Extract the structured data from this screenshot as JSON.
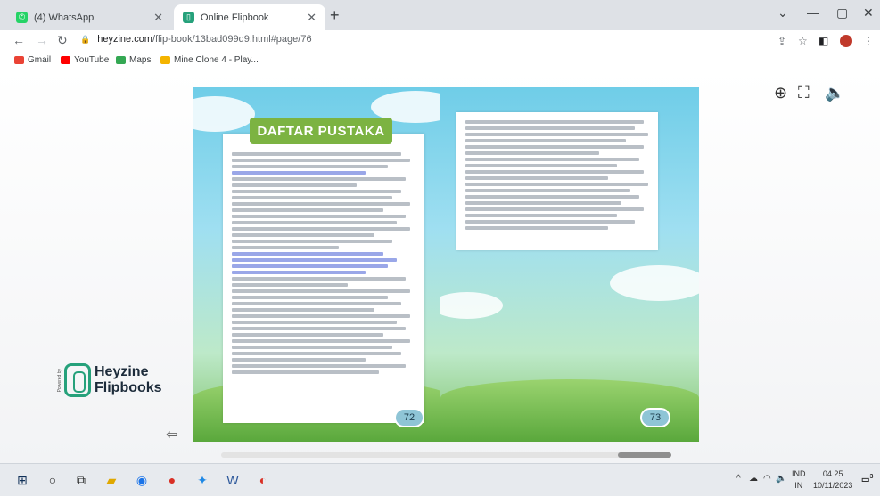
{
  "browser": {
    "tabs": [
      {
        "label": "(4) WhatsApp",
        "active": false,
        "icon": "whatsapp-icon",
        "color": "#25d366"
      },
      {
        "label": "Online Flipbook",
        "active": true,
        "icon": "heyzine-icon",
        "color": "#26a17b"
      }
    ],
    "new_tab": "+",
    "url": {
      "host": "heyzine.com",
      "path": "/flip-book/13bad099d9.html#page/76"
    },
    "bookmarks": [
      {
        "label": "Gmail",
        "icon": "gmail-icon",
        "color": "#ea4335"
      },
      {
        "label": "YouTube",
        "icon": "youtube-icon",
        "color": "#ff0000"
      },
      {
        "label": "Maps",
        "icon": "maps-icon",
        "color": "#34a853"
      },
      {
        "label": "Mine Clone 4 - Play...",
        "icon": "game-icon",
        "color": "#f4b400"
      }
    ]
  },
  "flipbook": {
    "heading": "DAFTAR PUSTAKA",
    "left_page_number": "72",
    "right_page_number": "73",
    "logo_line1": "Heyzine",
    "logo_line2": "Flipbooks",
    "logo_tag": "Powered by",
    "tools": [
      "zoom-in-icon",
      "fullscreen-icon",
      "sound-icon"
    ]
  },
  "taskbar": {
    "tray_lang_line1": "IND",
    "tray_lang_line2": "IN",
    "time": "04.25",
    "date": "10/11/2023",
    "notification_count": "3"
  },
  "colors": {
    "accent": "#7cb342",
    "brand": "#26a17b"
  }
}
